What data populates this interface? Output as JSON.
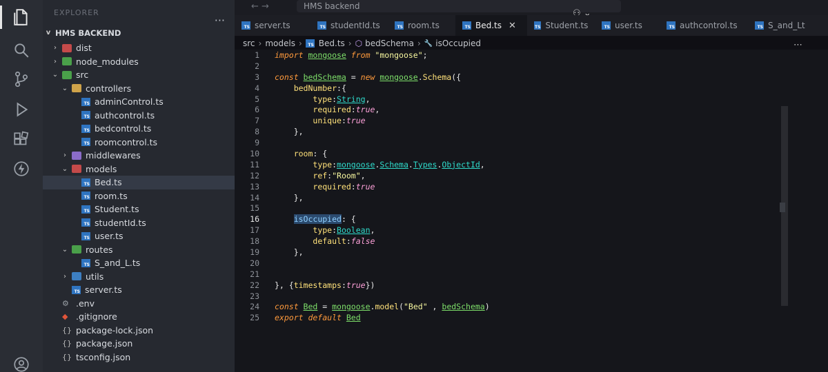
{
  "window": {
    "title": "HMS backend"
  },
  "explorer": {
    "header": "EXPLORER",
    "project": "HMS BACKEND",
    "items": [
      {
        "label": "dist",
        "depth": 0,
        "kind": "folder-red",
        "chev": ">"
      },
      {
        "label": "node_modules",
        "depth": 0,
        "kind": "folder-green",
        "chev": ">"
      },
      {
        "label": "src",
        "depth": 0,
        "kind": "folder-green",
        "chev": "v"
      },
      {
        "label": "controllers",
        "depth": 1,
        "kind": "folder",
        "chev": "v"
      },
      {
        "label": "adminControl.ts",
        "depth": 2,
        "kind": "ts"
      },
      {
        "label": "authcontrol.ts",
        "depth": 2,
        "kind": "ts"
      },
      {
        "label": "bedcontrol.ts",
        "depth": 2,
        "kind": "ts"
      },
      {
        "label": "roomcontrol.ts",
        "depth": 2,
        "kind": "ts"
      },
      {
        "label": "middlewares",
        "depth": 1,
        "kind": "folder-purple",
        "chev": ">"
      },
      {
        "label": "models",
        "depth": 1,
        "kind": "folder-red",
        "chev": "v"
      },
      {
        "label": "Bed.ts",
        "depth": 2,
        "kind": "ts",
        "selected": true
      },
      {
        "label": "room.ts",
        "depth": 2,
        "kind": "ts"
      },
      {
        "label": "Student.ts",
        "depth": 2,
        "kind": "ts"
      },
      {
        "label": "studentId.ts",
        "depth": 2,
        "kind": "ts"
      },
      {
        "label": "user.ts",
        "depth": 2,
        "kind": "ts"
      },
      {
        "label": "routes",
        "depth": 1,
        "kind": "folder-green",
        "chev": "v"
      },
      {
        "label": "S_and_L.ts",
        "depth": 2,
        "kind": "ts"
      },
      {
        "label": "utils",
        "depth": 1,
        "kind": "folder-blue",
        "chev": ">"
      },
      {
        "label": "server.ts",
        "depth": 1,
        "kind": "ts"
      },
      {
        "label": ".env",
        "depth": 0,
        "kind": "gear"
      },
      {
        "label": ".gitignore",
        "depth": 0,
        "kind": "git"
      },
      {
        "label": "package-lock.json",
        "depth": 0,
        "kind": "json"
      },
      {
        "label": "package.json",
        "depth": 0,
        "kind": "json"
      },
      {
        "label": "tsconfig.json",
        "depth": 0,
        "kind": "json"
      }
    ]
  },
  "tabs": [
    {
      "label": "server.ts"
    },
    {
      "label": "studentId.ts"
    },
    {
      "label": "room.ts"
    },
    {
      "label": "Bed.ts",
      "active": true
    },
    {
      "label": "Student.ts"
    },
    {
      "label": "user.ts"
    },
    {
      "label": "authcontrol.ts"
    },
    {
      "label": "S_and_Lt"
    }
  ],
  "breadcrumb": [
    "src",
    "models",
    "Bed.ts",
    "bedSchema",
    "isOccupied"
  ],
  "editor": {
    "current_line": 16,
    "lines": [
      [
        [
          "kw2",
          "import "
        ],
        [
          "var",
          "mongoose"
        ],
        [
          "pun",
          " "
        ],
        [
          "kw2",
          "from "
        ],
        [
          "str",
          "\"mongoose\""
        ],
        [
          "pun",
          ";"
        ]
      ],
      [],
      [
        [
          "kw2",
          "const "
        ],
        [
          "var",
          "bedSchema"
        ],
        [
          "pun",
          " = "
        ],
        [
          "kw2",
          "new "
        ],
        [
          "var",
          "mongoose"
        ],
        [
          "pun",
          "."
        ],
        [
          "prop",
          "Schema"
        ],
        [
          "pun",
          "({"
        ]
      ],
      [
        [
          "pun",
          "    "
        ],
        [
          "prop",
          "bedNumber"
        ],
        [
          "pun",
          ":{"
        ]
      ],
      [
        [
          "pun",
          "        "
        ],
        [
          "prop",
          "type"
        ],
        [
          "pun",
          ":"
        ],
        [
          "cls",
          "String"
        ],
        [
          "pun",
          ","
        ]
      ],
      [
        [
          "pun",
          "        "
        ],
        [
          "prop",
          "required"
        ],
        [
          "pun",
          ":"
        ],
        [
          "lit",
          "true"
        ],
        [
          "pun",
          ","
        ]
      ],
      [
        [
          "pun",
          "        "
        ],
        [
          "prop",
          "unique"
        ],
        [
          "pun",
          ":"
        ],
        [
          "lit",
          "true"
        ]
      ],
      [
        [
          "pun",
          "    },"
        ]
      ],
      [],
      [
        [
          "pun",
          "    "
        ],
        [
          "prop",
          "room"
        ],
        [
          "pun",
          ": {"
        ]
      ],
      [
        [
          "pun",
          "        "
        ],
        [
          "prop",
          "type"
        ],
        [
          "pun",
          ":"
        ],
        [
          "cls",
          "mongoose"
        ],
        [
          "pun",
          "."
        ],
        [
          "cls",
          "Schema"
        ],
        [
          "pun",
          "."
        ],
        [
          "cls",
          "Types"
        ],
        [
          "pun",
          "."
        ],
        [
          "cls",
          "ObjectId"
        ],
        [
          "pun",
          ","
        ]
      ],
      [
        [
          "pun",
          "        "
        ],
        [
          "prop",
          "ref"
        ],
        [
          "pun",
          ":"
        ],
        [
          "str",
          "\"Room\""
        ],
        [
          "pun",
          ","
        ]
      ],
      [
        [
          "pun",
          "        "
        ],
        [
          "prop",
          "required"
        ],
        [
          "pun",
          ":"
        ],
        [
          "lit",
          "true"
        ]
      ],
      [
        [
          "pun",
          "    },"
        ]
      ],
      [],
      [
        [
          "pun",
          "    "
        ],
        [
          "hl",
          "isOccupied"
        ],
        [
          "pun",
          ": {"
        ]
      ],
      [
        [
          "pun",
          "        "
        ],
        [
          "prop",
          "type"
        ],
        [
          "pun",
          ":"
        ],
        [
          "cls",
          "Boolean"
        ],
        [
          "pun",
          ","
        ]
      ],
      [
        [
          "pun",
          "        "
        ],
        [
          "prop",
          "default"
        ],
        [
          "pun",
          ":"
        ],
        [
          "lit",
          "false"
        ]
      ],
      [
        [
          "pun",
          "    },"
        ]
      ],
      [],
      [],
      [
        [
          "pun",
          "}, {"
        ],
        [
          "prop",
          "timestamps"
        ],
        [
          "pun",
          ":"
        ],
        [
          "lit",
          "true"
        ],
        [
          "pun",
          "})"
        ]
      ],
      [],
      [
        [
          "kw2",
          "const "
        ],
        [
          "var",
          "Bed"
        ],
        [
          "pun",
          " = "
        ],
        [
          "var",
          "mongoose"
        ],
        [
          "pun",
          "."
        ],
        [
          "prop",
          "model"
        ],
        [
          "pun",
          "("
        ],
        [
          "str",
          "\"Bed\""
        ],
        [
          "pun",
          " , "
        ],
        [
          "var",
          "bedSchema"
        ],
        [
          "pun",
          ")"
        ]
      ],
      [
        [
          "kw2",
          "export default "
        ],
        [
          "var",
          "Bed"
        ]
      ]
    ]
  },
  "colors": {
    "activity_bar": "#2a2d34",
    "sidebar": "#262930",
    "editor_bg": "#15161b",
    "keyword": "#ff9a3c",
    "variable": "#7ee06a",
    "class": "#2fdccc",
    "string": "#f8f8a0",
    "literal": "#fda0d8"
  }
}
